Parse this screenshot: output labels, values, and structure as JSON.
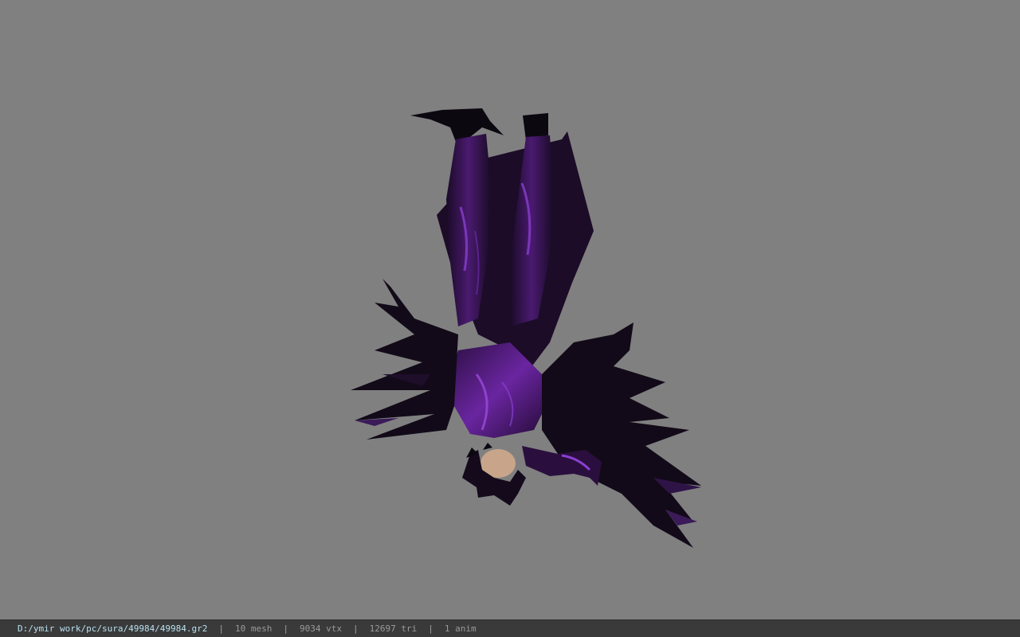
{
  "status": {
    "file_path": "D:/ymir work/pc/sura/49984/49984.gr2",
    "separator": "|",
    "mesh": "10 mesh",
    "vertices": "9034 vtx",
    "triangles": "12697 tri",
    "animations": "1 anim"
  },
  "viewport": {
    "background": "#808080",
    "model_colors": {
      "armor_dark": "#140a1c",
      "armor_purple": "#3a1358",
      "highlight": "#7a2fb0",
      "skin": "#c8a58a"
    }
  }
}
